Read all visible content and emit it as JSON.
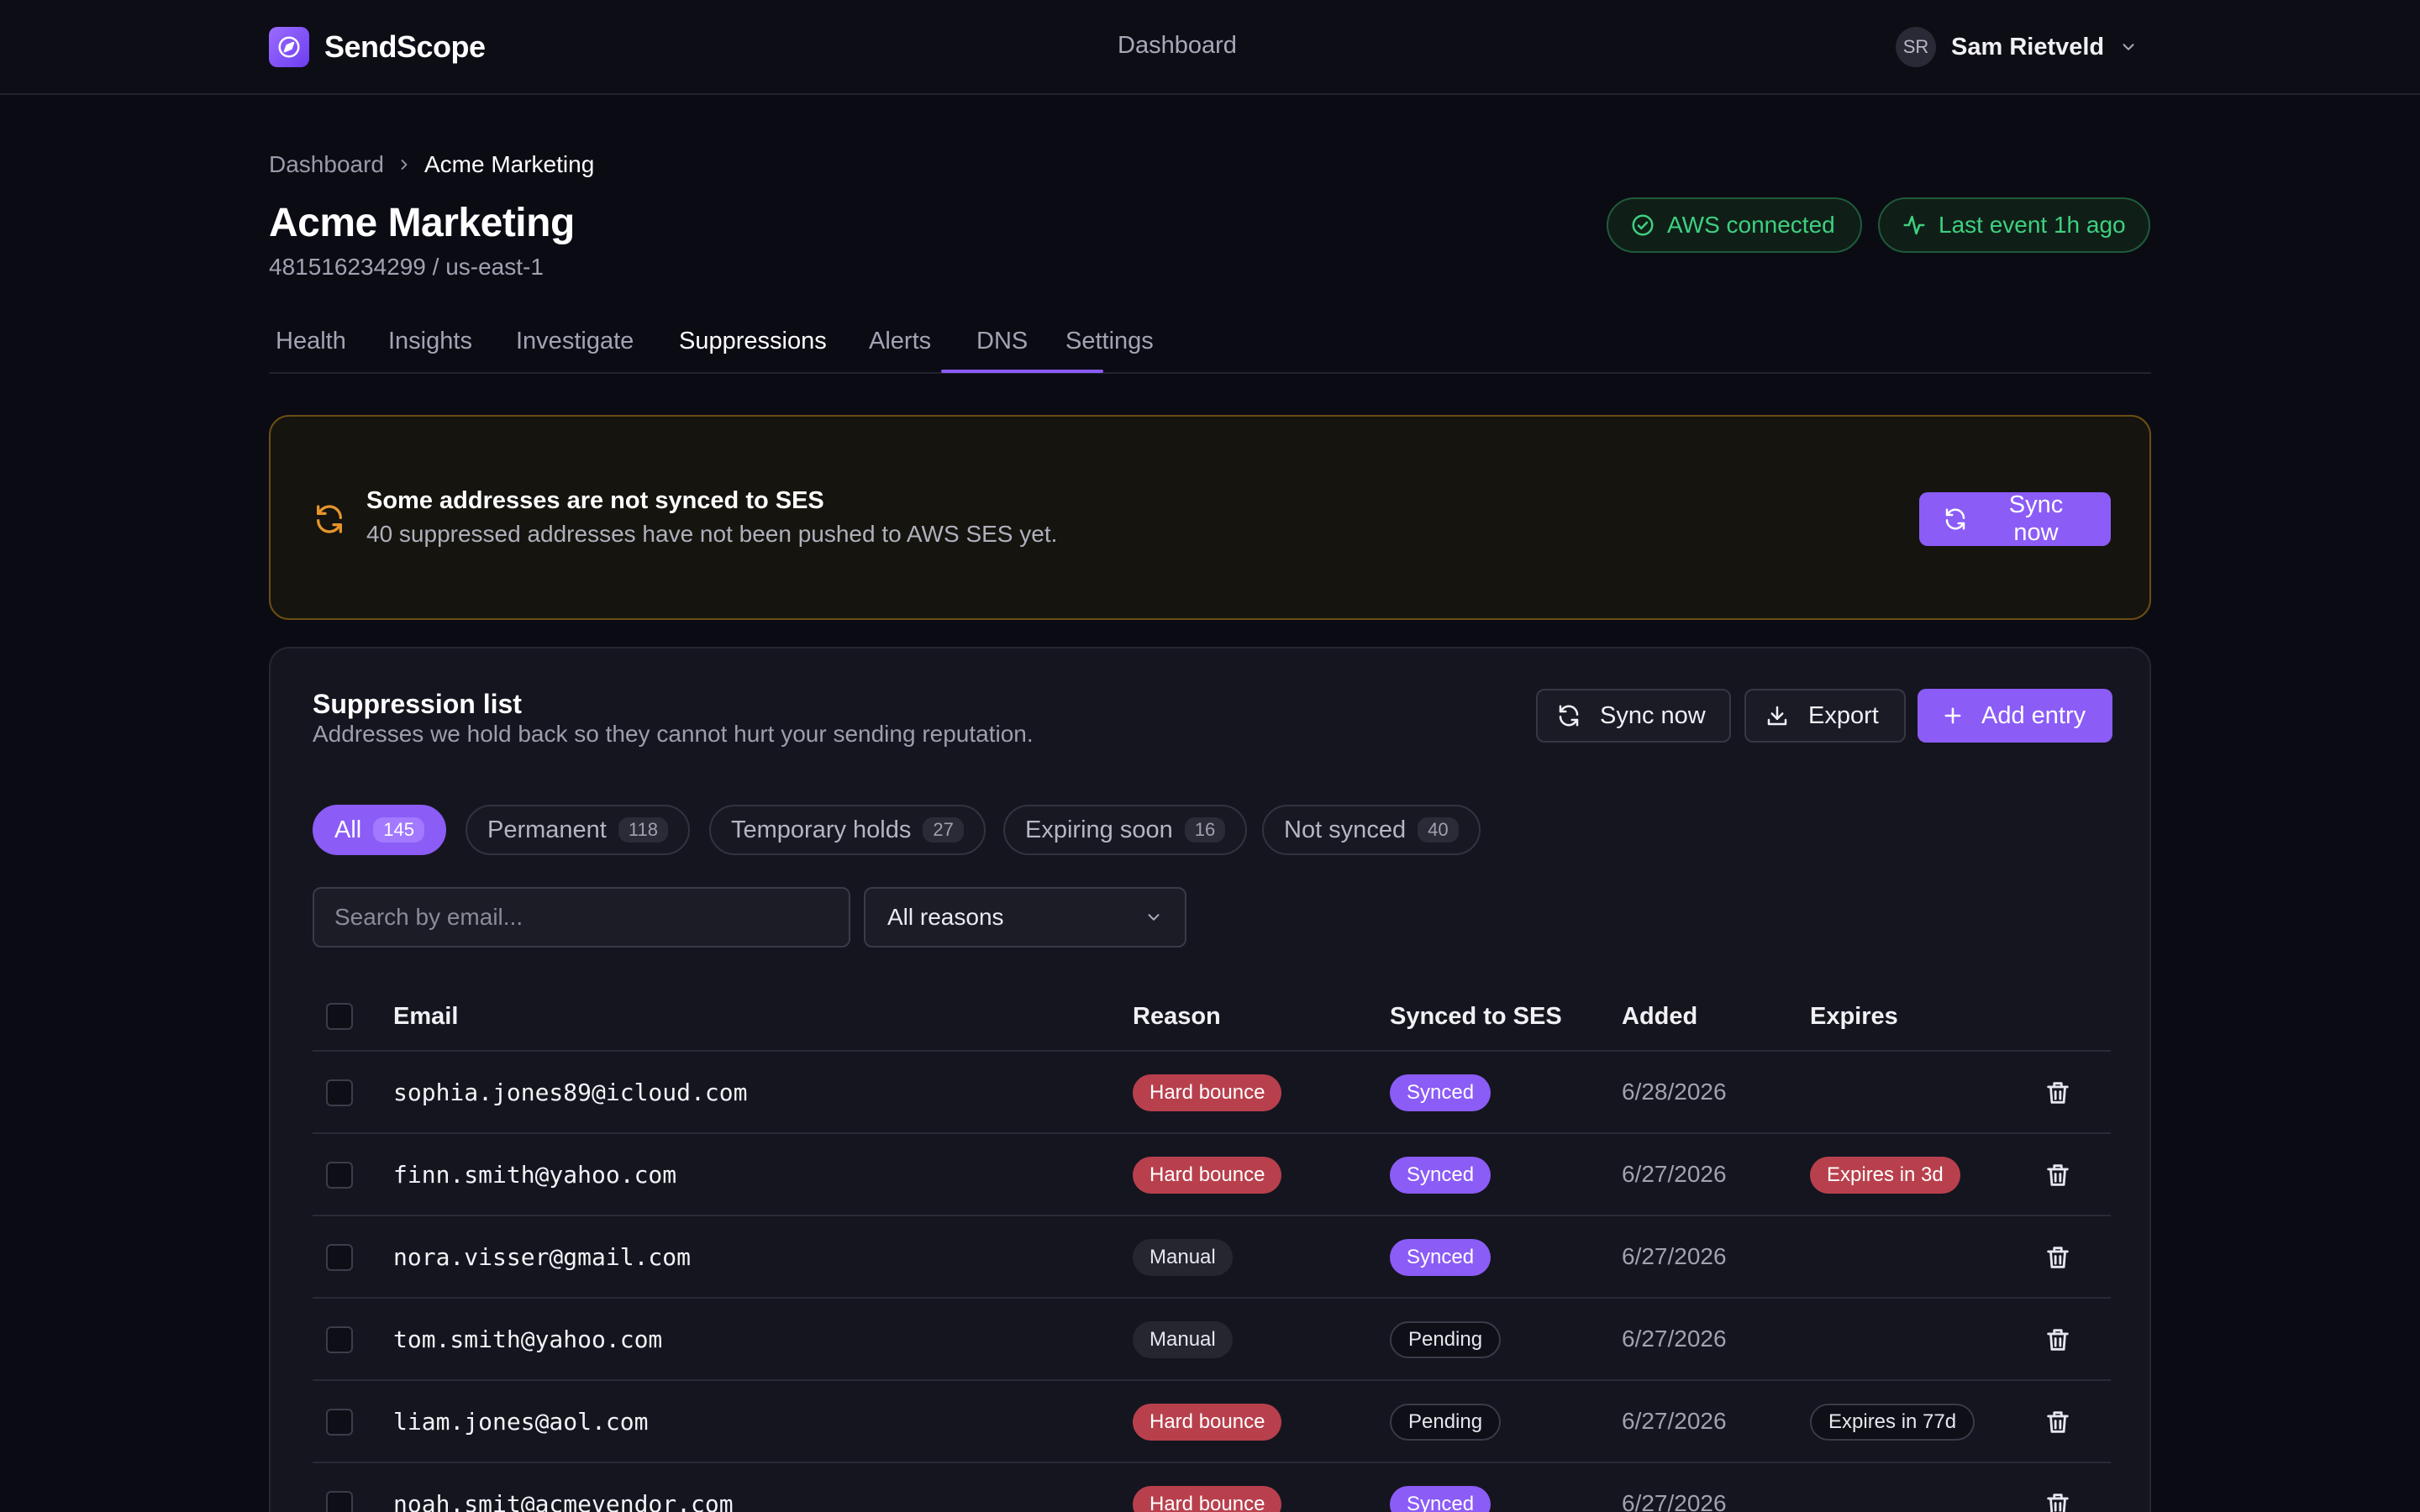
{
  "app": {
    "brand": "SendScope",
    "nav_center": "Dashboard",
    "user": {
      "initials": "SR",
      "name": "Sam Rietveld"
    }
  },
  "breadcrumb": {
    "home": "Dashboard",
    "current": "Acme Marketing"
  },
  "page": {
    "title": "Acme Marketing",
    "subtitle": "481516234299 / us-east-1",
    "status_aws": "AWS connected",
    "status_event": "Last event 1h ago"
  },
  "tabs": [
    "Health",
    "Insights",
    "Investigate",
    "Suppressions",
    "Alerts",
    "DNS",
    "Settings"
  ],
  "active_tab": "Suppressions",
  "banner": {
    "title": "Some addresses are not synced to SES",
    "text": "40 suppressed addresses have not been pushed to AWS SES yet.",
    "button": "Sync now"
  },
  "card": {
    "title": "Suppression list",
    "subtitle": "Addresses we hold back so they cannot hurt your sending reputation.",
    "sync_button": "Sync now",
    "export_button": "Export",
    "add_button": "Add entry"
  },
  "filters": [
    {
      "label": "All",
      "count": "145",
      "active": true
    },
    {
      "label": "Permanent",
      "count": "118",
      "active": false
    },
    {
      "label": "Temporary holds",
      "count": "27",
      "active": false
    },
    {
      "label": "Expiring soon",
      "count": "16",
      "active": false
    },
    {
      "label": "Not synced",
      "count": "40",
      "active": false
    }
  ],
  "search": {
    "placeholder": "Search by email...",
    "value": ""
  },
  "reason_select": {
    "selected": "All reasons"
  },
  "table": {
    "headers": {
      "email": "Email",
      "reason": "Reason",
      "synced": "Synced to SES",
      "added": "Added",
      "expires": "Expires"
    },
    "rows": [
      {
        "email": "sophia.jones89@icloud.com",
        "reason": "Hard bounce",
        "synced": "Synced",
        "added": "6/28/2026",
        "expires": ""
      },
      {
        "email": "finn.smith@yahoo.com",
        "reason": "Hard bounce",
        "synced": "Synced",
        "added": "6/27/2026",
        "expires": "Expires in 3d"
      },
      {
        "email": "nora.visser@gmail.com",
        "reason": "Manual",
        "synced": "Synced",
        "added": "6/27/2026",
        "expires": ""
      },
      {
        "email": "tom.smith@yahoo.com",
        "reason": "Manual",
        "synced": "Pending",
        "added": "6/27/2026",
        "expires": ""
      },
      {
        "email": "liam.jones@aol.com",
        "reason": "Hard bounce",
        "synced": "Pending",
        "added": "6/27/2026",
        "expires": "Expires in 77d"
      },
      {
        "email": "noah.smit@acmevendor.com",
        "reason": "Hard bounce",
        "synced": "Synced",
        "added": "6/27/2026",
        "expires": ""
      }
    ]
  },
  "colors": {
    "accent": "#8b5cf6",
    "success": "#3fd07f",
    "danger": "#b8404d",
    "warning_border": "#6b4f12",
    "warning_icon": "#e5952b"
  },
  "icons": {
    "brand": "send-compass-icon",
    "user_menu": "chevron-down-icon",
    "breadcrumb_separator": "chevron-right-icon",
    "aws_status": "check-circle-icon",
    "event_status": "activity-icon",
    "banner": "refresh-icon",
    "sync": "refresh-icon",
    "export": "download-icon",
    "add": "plus-icon",
    "select": "chevron-down-icon",
    "delete": "trash-icon"
  }
}
